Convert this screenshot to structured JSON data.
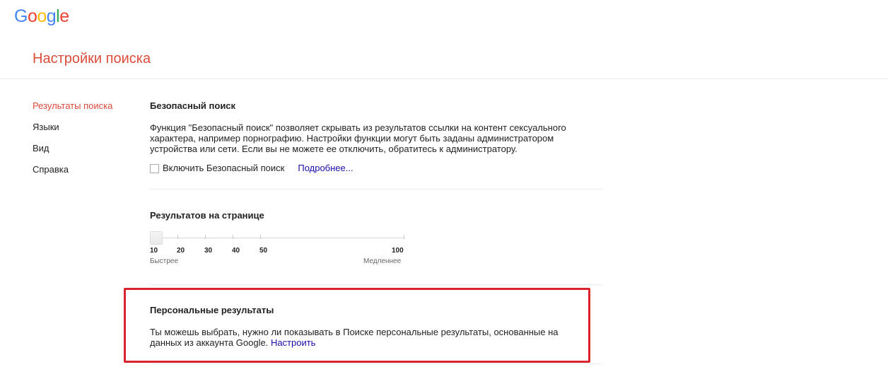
{
  "logo": {
    "letters": [
      "G",
      "o",
      "o",
      "g",
      "l",
      "e"
    ],
    "colors": [
      "#4285f4",
      "#ea4335",
      "#fbbc05",
      "#4285f4",
      "#34a853",
      "#ea4335"
    ]
  },
  "page_title": "Настройки поиска",
  "sidebar": {
    "items": [
      {
        "label": "Результаты поиска",
        "active": true
      },
      {
        "label": "Языки",
        "active": false
      },
      {
        "label": "Вид",
        "active": false
      },
      {
        "label": "Справка",
        "active": false
      }
    ]
  },
  "safe_search": {
    "title": "Безопасный поиск",
    "description": "Функция \"Безопасный поиск\" позволяет скрывать из результатов ссылки на контент сексуального характера, например порнографию. Настройки функции могут быть заданы администратором устройства или сети. Если вы не можете ее отключить, обратитесь к администратору.",
    "checkbox_label": "Включить Безопасный поиск",
    "checked": false,
    "more_link": "Подробнее..."
  },
  "results_per_page": {
    "title": "Результатов на странице",
    "value": 10,
    "ticks": [
      "10",
      "20",
      "30",
      "40",
      "50",
      "100"
    ],
    "faster_label": "Быстрее",
    "slower_label": "Медленнее"
  },
  "personal_results": {
    "title": "Персональные результаты",
    "description": "Ты можешь выбрать, нужно ли показывать в Поиске персональные результаты, основанные на данных из аккаунта Google.",
    "link": "Настроить"
  },
  "colors": {
    "accent_red": "#dd4b39",
    "link_blue": "#1a0dab",
    "highlight_red": "#d9232d"
  }
}
